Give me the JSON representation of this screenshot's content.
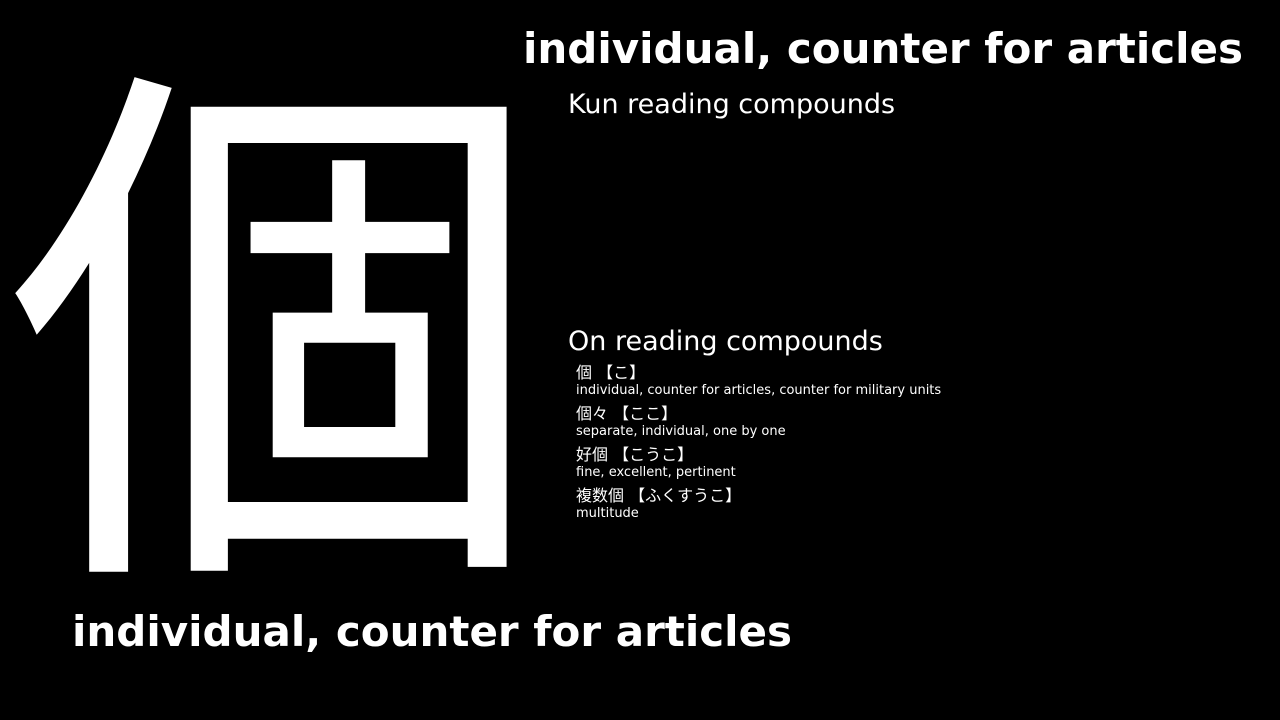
{
  "kanji": "個",
  "meaning": "individual, counter for articles",
  "kun_section": {
    "title": "Kun reading compounds",
    "compounds": []
  },
  "on_section": {
    "title": "On reading compounds",
    "compounds": [
      {
        "word": "個 【こ】",
        "meaning": "individual, counter for articles, counter for military units"
      },
      {
        "word": "個々 【ここ】",
        "meaning": "separate, individual, one by one"
      },
      {
        "word": "好個 【こうこ】",
        "meaning": "fine, excellent, pertinent"
      },
      {
        "word": "複数個 【ふくすうこ】",
        "meaning": "multitude"
      }
    ]
  },
  "colors": {
    "background": "#000000",
    "text": "#ffffff"
  }
}
